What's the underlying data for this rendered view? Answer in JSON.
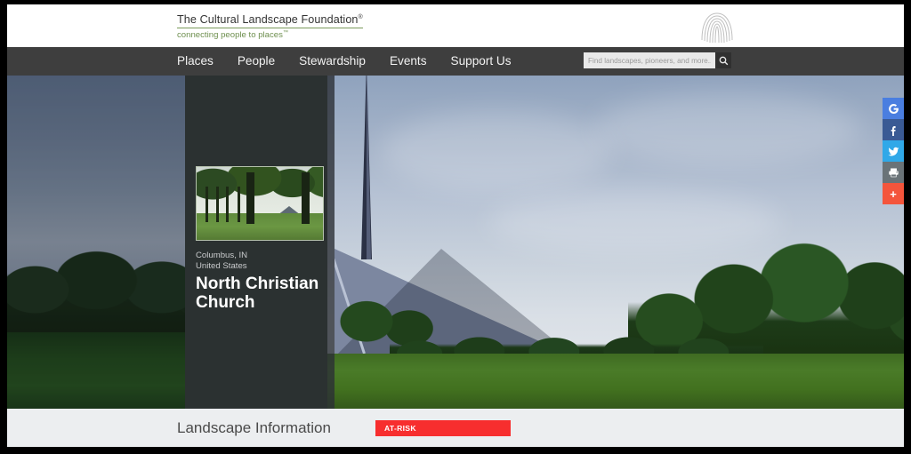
{
  "site": {
    "logo_title": "The Cultural Landscape Foundation",
    "logo_registered": "®",
    "logo_tagline": "connecting people to places",
    "logo_tagline_tm": "™",
    "mark_icon": "fingerprint-icon"
  },
  "nav": {
    "items": [
      {
        "label": "Places"
      },
      {
        "label": "People"
      },
      {
        "label": "Stewardship"
      },
      {
        "label": "Events"
      },
      {
        "label": "Support Us"
      }
    ]
  },
  "search": {
    "placeholder": "Find landscapes, pioneers, and more...",
    "value": "",
    "button_icon": "search-icon"
  },
  "hero": {
    "location_line1": "Columbus, IN",
    "location_line2": "United States",
    "title": "North Christian Church",
    "thumbnail_alt": "North Christian Church lawn with trees",
    "image_alt": "North Christian Church spire and roof under cloudy sky"
  },
  "share": {
    "items": [
      {
        "name": "google-plus-share-button",
        "icon": "google-icon",
        "label": "G",
        "color": "#4a7ee0"
      },
      {
        "name": "facebook-share-button",
        "icon": "facebook-icon",
        "label": "f",
        "color": "#3a5a94"
      },
      {
        "name": "twitter-share-button",
        "icon": "twitter-icon",
        "label": "",
        "color": "#30a8e8"
      },
      {
        "name": "print-button",
        "icon": "printer-icon",
        "label": "",
        "color": "#6a7378"
      },
      {
        "name": "more-share-button",
        "icon": "plus-icon",
        "label": "+",
        "color": "#f4553c"
      }
    ]
  },
  "info": {
    "title": "Landscape Information",
    "risk_badge": "AT-RISK",
    "risk_color": "#f72e2e"
  }
}
